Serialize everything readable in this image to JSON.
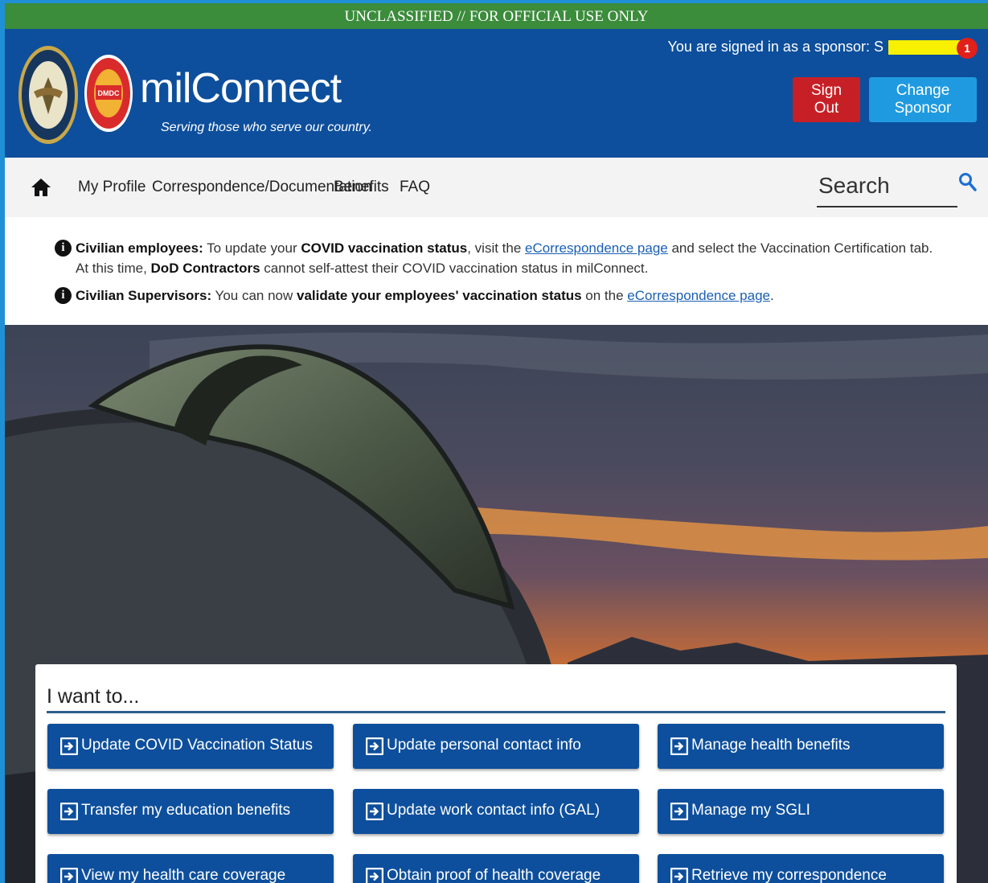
{
  "classification_banner": "UNCLASSIFIED // FOR OFFICIAL USE ONLY",
  "header": {
    "logo_text": "milConnect",
    "tagline": "Serving those who serve our country.",
    "signed_in_text": "You are signed in as a sponsor: S",
    "notification_count": "1",
    "sign_out_label": "Sign Out",
    "change_sponsor_label": "Change Sponsor",
    "seal_left": "DoD seal",
    "seal_right": "DMDC",
    "colors": {
      "header_bg": "#0d4f9c",
      "banner_bg": "#3b8c3b",
      "sign_out": "#c62026",
      "change_sponsor": "#1f9ae0"
    }
  },
  "nav": {
    "home_icon": "home-icon",
    "items": [
      "My Profile",
      "Correspondence/Documentation",
      "Benefits",
      "FAQ"
    ],
    "search_placeholder": "Search"
  },
  "alerts": [
    {
      "bold1": "Civilian employees:",
      "t1": " To update your ",
      "bold2": "COVID vaccination status",
      "t2": ", visit the ",
      "link": "eCorrespondence page",
      "t3": " and select the Vaccination Certification tab. At this time, ",
      "bold3": "DoD Contractors",
      "t4": " cannot self-attest their COVID vaccination status in milConnect."
    },
    {
      "bold1": "Civilian Supervisors:",
      "t1": " You can now ",
      "bold2": "validate your employees' vaccination status",
      "t2": " on the ",
      "link": "eCorrespondence page",
      "t3": "."
    }
  ],
  "i_want_to": {
    "title": "I want to...",
    "actions": [
      "Update COVID Vaccination Status",
      "Update personal contact info",
      "Manage health benefits",
      "Transfer my education benefits",
      "Update work contact info (GAL)",
      "Manage my SGLI",
      "View my health care coverage",
      "Obtain proof of health coverage",
      "Retrieve my correspondence"
    ]
  }
}
